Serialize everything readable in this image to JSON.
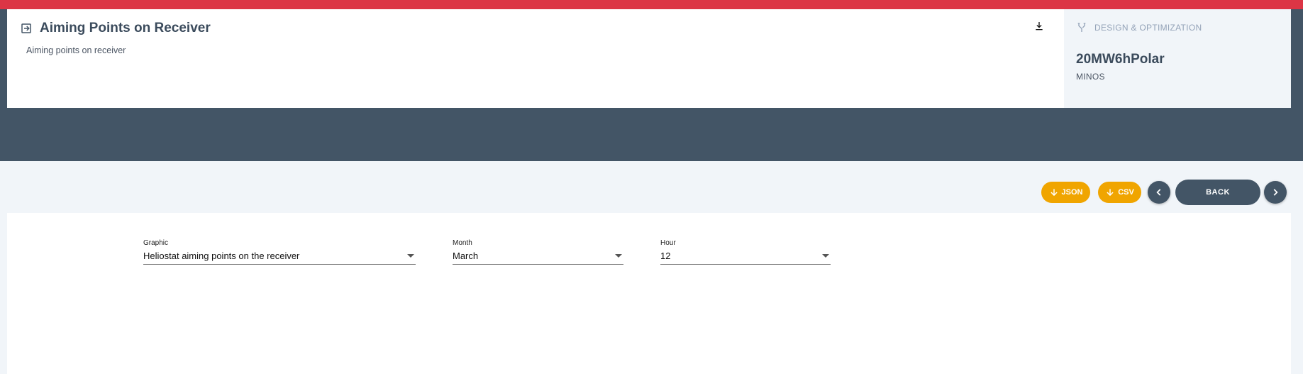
{
  "header": {
    "title": "Aiming Points on Receiver",
    "subtitle": "Aiming points on receiver"
  },
  "side": {
    "section_label": "DESIGN & OPTIMIZATION",
    "project_name": "20MW6hPolar",
    "project_sub": "MINOS"
  },
  "actions": {
    "json_label": "JSON",
    "csv_label": "CSV",
    "back_label": "BACK"
  },
  "filters": {
    "graphic": {
      "label": "Graphic",
      "value": "Heliostat aiming points on the receiver"
    },
    "month": {
      "label": "Month",
      "value": "March"
    },
    "hour": {
      "label": "Hour",
      "value": "12"
    }
  },
  "colors": {
    "top_bar": "#dc3545",
    "dark_band": "#435566",
    "accent": "#f0a500"
  },
  "icons": [
    "exit-to-app-icon",
    "download-icon",
    "fork-icon",
    "arrow-down-icon",
    "chevron-left-icon",
    "chevron-right-icon",
    "caret-down-icon"
  ]
}
